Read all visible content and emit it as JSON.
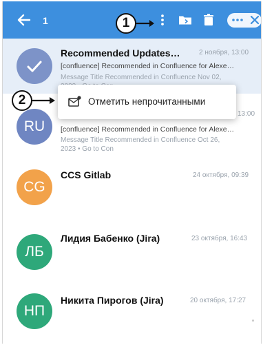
{
  "toolbar": {
    "selected_count": "1",
    "icons": [
      "back-arrow-icon",
      "more-vertical-icon",
      "folder-icon",
      "trash-icon",
      "more-horizontal-icon",
      "close-icon"
    ]
  },
  "markers": {
    "first": "1",
    "second": "2"
  },
  "context_menu": {
    "label": "Отметить непрочитанными",
    "icon": "mark-unread-icon"
  },
  "messages": [
    {
      "avatar": "",
      "avatar_color": "#7d93c8",
      "sender": "Recommended Updates…",
      "date": "2 ноября, 13:00",
      "subject": "[confluence] Recommended in Confluence for Alexe…",
      "preview": "Message Title Recommended in Confluence Nov 02,",
      "preview2": "2023 • Go to Con",
      "selected": true
    },
    {
      "avatar": "RU",
      "avatar_color": "#6f86c2",
      "sender": "",
      "date": "13:00",
      "subject": "[confluence] Recommended in Confluence for Alexe…",
      "preview": "Message Title Recommended in Confluence Oct 26,",
      "preview2": "2023 • Go to Con"
    },
    {
      "avatar": "CG",
      "avatar_color": "#f2a24a",
      "sender": "CCS Gitlab",
      "date": "24 октября, 09:39"
    },
    {
      "avatar": "ЛБ",
      "avatar_color": "#2ea87a",
      "sender": "Лидия Бабенко (Jira)",
      "date": "23 октября, 16:43"
    },
    {
      "avatar": "НП",
      "avatar_color": "#2ea87a",
      "sender": "Никита Пирогов (Jira)",
      "date": "20 октября, 17:27"
    }
  ]
}
